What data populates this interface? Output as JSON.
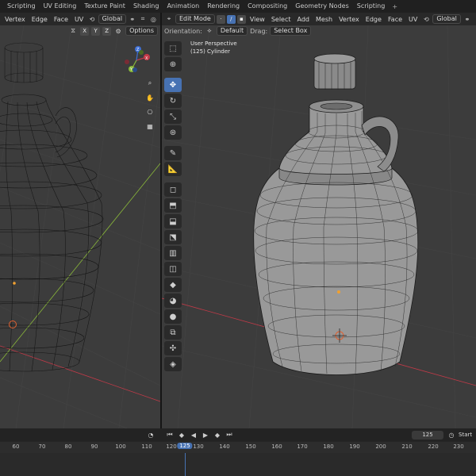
{
  "workspace_tabs": [
    "Scripting",
    "UV Editing",
    "Texture Paint",
    "Shading",
    "Animation",
    "Rendering",
    "Compositing",
    "Geometry Nodes",
    "Scripting"
  ],
  "workspace_add": "+",
  "left_viewport": {
    "menu": [
      "Vertex",
      "Edge",
      "Face",
      "UV"
    ],
    "transform_orientation": "Global",
    "axes": [
      "X",
      "Y",
      "Z"
    ],
    "options_label": "Options"
  },
  "right_viewport": {
    "mode": "Edit Mode",
    "menu": [
      "View",
      "Select",
      "Add",
      "Mesh",
      "Vertex",
      "Edge",
      "Face",
      "UV"
    ],
    "transform_orientation": "Global",
    "orientation_label": "Orientation:",
    "orientation_value": "Default",
    "drag_label": "Drag:",
    "drag_value": "Select Box",
    "view_name": "User Perspective",
    "object_name": "(125) Cylinder",
    "tools": [
      "select-box",
      "cursor",
      "move",
      "rotate",
      "scale",
      "transform",
      "annotate",
      "measure",
      "add-cube",
      "extrude",
      "inset",
      "bevel",
      "loop-cut",
      "knife",
      "poly-build",
      "spin",
      "smooth",
      "shrink-fatten",
      "shear",
      "rip"
    ]
  },
  "navigation_gizmo": {
    "x": "X",
    "y": "Y",
    "z": "Z"
  },
  "timeline": {
    "ticks": [
      "60",
      "70",
      "80",
      "90",
      "100",
      "110",
      "120",
      "130",
      "140",
      "150",
      "160",
      "170",
      "180",
      "190",
      "200",
      "210",
      "220",
      "230"
    ],
    "current_frame": "125",
    "frame_field": "125",
    "start_label": "Start"
  },
  "colors": {
    "accent": "#4772b3",
    "viewport_bg": "#3c3c3c",
    "x_axis": "#c33a48",
    "y_axis": "#8ab83a",
    "z_axis": "#3f6fd3"
  }
}
